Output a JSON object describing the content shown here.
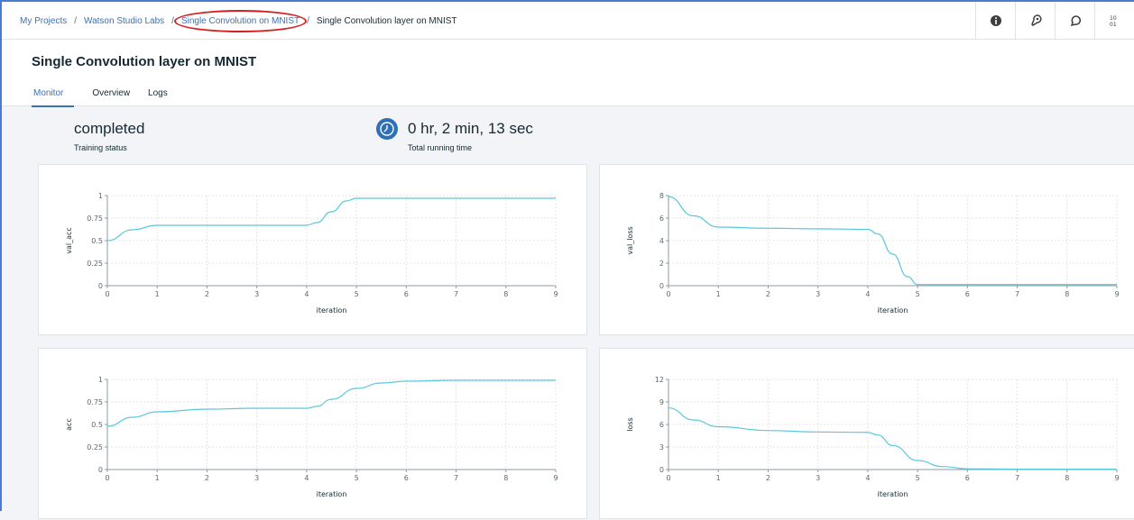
{
  "breadcrumb": [
    "My Projects",
    "Watson Studio Labs",
    "Single Convolution on MNIST",
    "Single Convolution layer on MNIST"
  ],
  "toolbar": {
    "icons": [
      "info-icon",
      "deploy-icon",
      "comment-icon",
      "data-icon"
    ]
  },
  "page": {
    "title": "Single Convolution layer on MNIST"
  },
  "tabs": [
    "Monitor",
    "Overview",
    "Logs"
  ],
  "summary": {
    "status_value": "completed",
    "status_label": "Training status",
    "runtime_value": "0 hr, 2 min, 13 sec",
    "runtime_label": "Total running time"
  },
  "colors": {
    "line": "#5ac8dc",
    "accent": "#3d70b2",
    "highlight": "#d32020"
  },
  "chart_data": [
    {
      "type": "line",
      "xlabel": "iteration",
      "ylabel": "val_acc",
      "xlim": [
        0,
        9
      ],
      "ylim": [
        0,
        1
      ],
      "yticks": [
        "0",
        "0.25",
        "0.5",
        "0.75",
        "1"
      ],
      "xticks": [
        "0",
        "1",
        "2",
        "3",
        "4",
        "5",
        "6",
        "7",
        "8",
        "9"
      ],
      "x": [
        0,
        0.5,
        1,
        2,
        3,
        4,
        4.2,
        4.5,
        4.8,
        5,
        6,
        7,
        8,
        9
      ],
      "y": [
        0.5,
        0.62,
        0.67,
        0.67,
        0.67,
        0.67,
        0.7,
        0.82,
        0.94,
        0.97,
        0.97,
        0.97,
        0.97,
        0.97
      ]
    },
    {
      "type": "line",
      "xlabel": "iteration",
      "ylabel": "val_loss",
      "xlim": [
        0,
        9
      ],
      "ylim": [
        0,
        8
      ],
      "yticks": [
        "0",
        "2",
        "4",
        "6",
        "8"
      ],
      "xticks": [
        "0",
        "1",
        "2",
        "3",
        "4",
        "5",
        "6",
        "7",
        "8",
        "9"
      ],
      "x": [
        0,
        0.5,
        1,
        2,
        3,
        4,
        4.2,
        4.5,
        4.8,
        5,
        6,
        7,
        8,
        9
      ],
      "y": [
        7.9,
        6.2,
        5.2,
        5.1,
        5.05,
        5.0,
        4.6,
        2.8,
        0.8,
        0.1,
        0.1,
        0.1,
        0.1,
        0.1
      ]
    },
    {
      "type": "line",
      "xlabel": "iteration",
      "ylabel": "acc",
      "xlim": [
        0,
        9
      ],
      "ylim": [
        0,
        1
      ],
      "yticks": [
        "0",
        "0.25",
        "0.5",
        "0.75",
        "1"
      ],
      "xticks": [
        "0",
        "1",
        "2",
        "3",
        "4",
        "5",
        "6",
        "7",
        "8",
        "9"
      ],
      "x": [
        0,
        0.5,
        1,
        2,
        3,
        4,
        4.2,
        4.5,
        5,
        5.5,
        6,
        7,
        8,
        9
      ],
      "y": [
        0.48,
        0.58,
        0.64,
        0.67,
        0.68,
        0.68,
        0.7,
        0.78,
        0.9,
        0.96,
        0.98,
        0.99,
        0.99,
        0.99
      ]
    },
    {
      "type": "line",
      "xlabel": "iteration",
      "ylabel": "loss",
      "xlim": [
        0,
        9
      ],
      "ylim": [
        0,
        12
      ],
      "yticks": [
        "0",
        "3",
        "6",
        "9",
        "12"
      ],
      "xticks": [
        "0",
        "1",
        "2",
        "3",
        "4",
        "5",
        "6",
        "7",
        "8",
        "9"
      ],
      "x": [
        0,
        0.5,
        1,
        2,
        3,
        4,
        4.2,
        4.5,
        5,
        5.5,
        6,
        7,
        8,
        9
      ],
      "y": [
        8.2,
        6.6,
        5.7,
        5.2,
        5.0,
        4.95,
        4.6,
        3.2,
        1.2,
        0.4,
        0.1,
        0.05,
        0.05,
        0.05
      ]
    }
  ]
}
